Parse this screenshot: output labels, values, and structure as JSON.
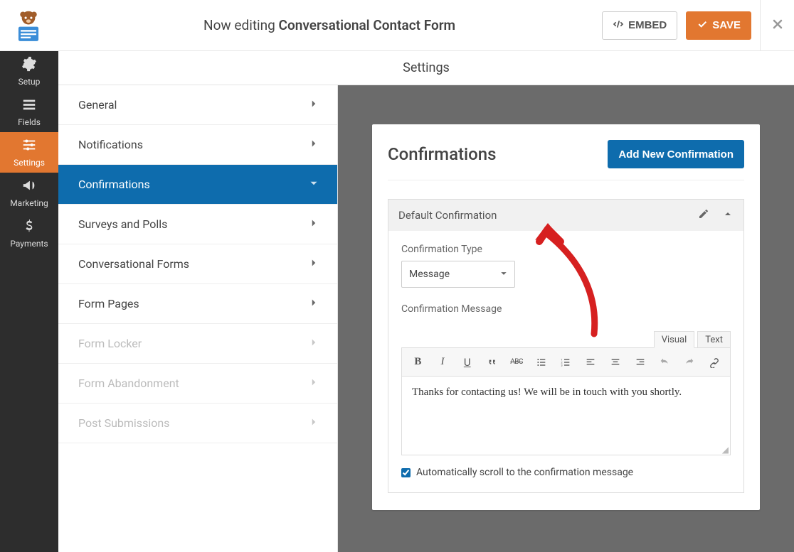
{
  "topbar": {
    "now_editing_prefix": "Now editing ",
    "form_name": "Conversational Contact Form",
    "embed_label": "EMBED",
    "save_label": "SAVE"
  },
  "rail": [
    {
      "id": "setup",
      "label": "Setup"
    },
    {
      "id": "fields",
      "label": "Fields"
    },
    {
      "id": "settings",
      "label": "Settings"
    },
    {
      "id": "marketing",
      "label": "Marketing"
    },
    {
      "id": "payments",
      "label": "Payments"
    }
  ],
  "sheet_title": "Settings",
  "submenu": [
    {
      "id": "general",
      "label": "General",
      "active": false,
      "disabled": false
    },
    {
      "id": "notifications",
      "label": "Notifications",
      "active": false,
      "disabled": false
    },
    {
      "id": "confirmations",
      "label": "Confirmations",
      "active": true,
      "disabled": false
    },
    {
      "id": "surveys",
      "label": "Surveys and Polls",
      "active": false,
      "disabled": false
    },
    {
      "id": "conversational",
      "label": "Conversational Forms",
      "active": false,
      "disabled": false
    },
    {
      "id": "formpages",
      "label": "Form Pages",
      "active": false,
      "disabled": false
    },
    {
      "id": "formlocker",
      "label": "Form Locker",
      "active": false,
      "disabled": true
    },
    {
      "id": "abandonment",
      "label": "Form Abandonment",
      "active": false,
      "disabled": true
    },
    {
      "id": "postsubs",
      "label": "Post Submissions",
      "active": false,
      "disabled": true
    }
  ],
  "content": {
    "heading": "Confirmations",
    "add_button": "Add New Confirmation",
    "panel_title": "Default Confirmation",
    "type_label": "Confirmation Type",
    "type_value": "Message",
    "message_label": "Confirmation Message",
    "tabs": {
      "visual": "Visual",
      "text": "Text"
    },
    "message_body": "Thanks for contacting us! We will be in touch with you shortly.",
    "autoscroll_label": "Automatically scroll to the confirmation message",
    "autoscroll_checked": true
  }
}
